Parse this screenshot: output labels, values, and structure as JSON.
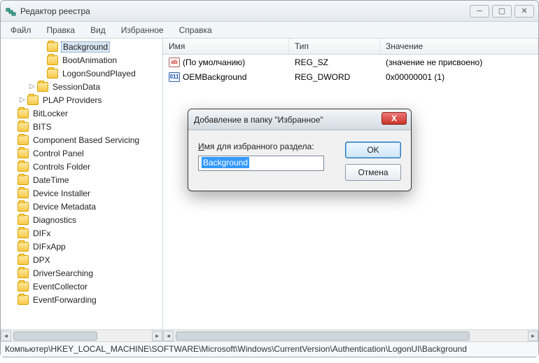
{
  "window": {
    "title": "Редактор реестра"
  },
  "menu": {
    "file": "Файл",
    "edit": "Правка",
    "view": "Вид",
    "favorites": "Избранное",
    "help": "Справка"
  },
  "tree": {
    "items": [
      {
        "indent": 52,
        "exp": "",
        "label": "Background",
        "selected": true
      },
      {
        "indent": 52,
        "exp": "",
        "label": "BootAnimation"
      },
      {
        "indent": 52,
        "exp": "",
        "label": "LogonSoundPlayed"
      },
      {
        "indent": 38,
        "exp": "▷",
        "label": "SessionData"
      },
      {
        "indent": 24,
        "exp": "▷",
        "label": "PLAP Providers"
      },
      {
        "indent": 10,
        "exp": "",
        "label": "BitLocker"
      },
      {
        "indent": 10,
        "exp": "",
        "label": "BITS"
      },
      {
        "indent": 10,
        "exp": "",
        "label": "Component Based Servicing"
      },
      {
        "indent": 10,
        "exp": "",
        "label": "Control Panel"
      },
      {
        "indent": 10,
        "exp": "",
        "label": "Controls Folder"
      },
      {
        "indent": 10,
        "exp": "",
        "label": "DateTime"
      },
      {
        "indent": 10,
        "exp": "",
        "label": "Device Installer"
      },
      {
        "indent": 10,
        "exp": "",
        "label": "Device Metadata"
      },
      {
        "indent": 10,
        "exp": "",
        "label": "Diagnostics"
      },
      {
        "indent": 10,
        "exp": "",
        "label": "DIFx"
      },
      {
        "indent": 10,
        "exp": "",
        "label": "DIFxApp"
      },
      {
        "indent": 10,
        "exp": "",
        "label": "DPX"
      },
      {
        "indent": 10,
        "exp": "",
        "label": "DriverSearching"
      },
      {
        "indent": 10,
        "exp": "",
        "label": "EventCollector"
      },
      {
        "indent": 10,
        "exp": "",
        "label": "EventForwarding"
      }
    ]
  },
  "list": {
    "cols": {
      "name": "Имя",
      "type": "Тип",
      "value": "Значение"
    },
    "rows": [
      {
        "icon": "str",
        "name": "(По умолчанию)",
        "type": "REG_SZ",
        "value": "(значение не присвоено)"
      },
      {
        "icon": "dword",
        "name": "OEMBackground",
        "type": "REG_DWORD",
        "value": "0x00000001 (1)"
      }
    ]
  },
  "status": {
    "path": "Компьютер\\HKEY_LOCAL_MACHINE\\SOFTWARE\\Microsoft\\Windows\\CurrentVersion\\Authentication\\LogonUI\\Background"
  },
  "dialog": {
    "title": "Добавление в папку \"Избранное\"",
    "label_prefix": "И",
    "label_rest": "мя для избранного раздела:",
    "input_value": "Background",
    "ok": "OK",
    "cancel": "Отмена"
  }
}
